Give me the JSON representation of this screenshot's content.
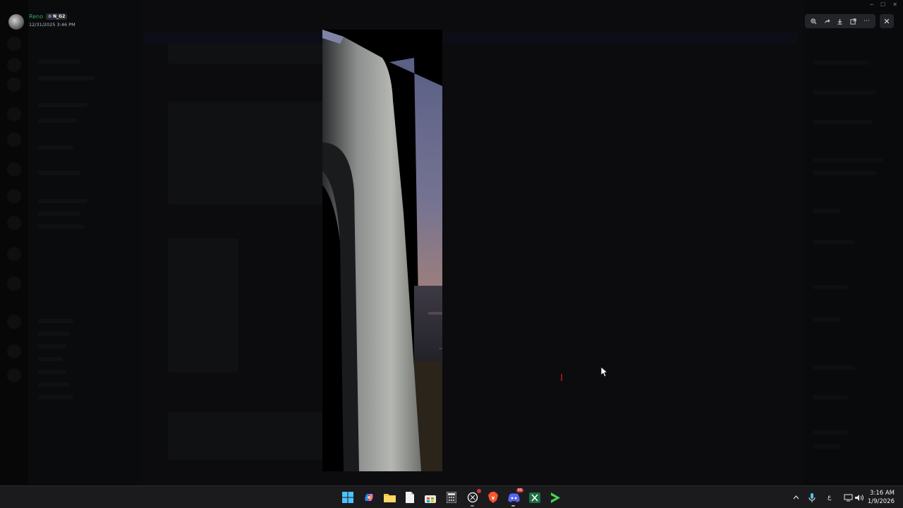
{
  "window": {
    "title": "",
    "controls": [
      "minimize-icon",
      "maximize-icon",
      "close-icon"
    ]
  },
  "viewer": {
    "author_name": "Reno",
    "author_tag": "N_G2",
    "timestamp": "12/31/2025 3:46 PM",
    "toolbar_icons": [
      "zoom-in-icon",
      "share-icon",
      "download-icon",
      "open-external-icon",
      "more-icon"
    ],
    "close_icon": "close-icon"
  },
  "taskbar": {
    "apps": [
      {
        "name": "start",
        "icon": "windows-start-icon"
      },
      {
        "name": "copilot",
        "icon": "copilot-icon"
      },
      {
        "name": "file-explorer",
        "icon": "folder-icon"
      },
      {
        "name": "notepad",
        "icon": "document-icon"
      },
      {
        "name": "store",
        "icon": "store-icon"
      },
      {
        "name": "calculator",
        "icon": "calculator-icon"
      },
      {
        "name": "chatgpt",
        "icon": "ai-icon"
      },
      {
        "name": "brave",
        "icon": "brave-icon"
      },
      {
        "name": "discord",
        "icon": "discord-icon",
        "badge": "99"
      },
      {
        "name": "excel",
        "icon": "excel-icon"
      },
      {
        "name": "media-player",
        "icon": "play-icon"
      }
    ],
    "tray_ime": "ع",
    "time": "3:16 AM",
    "date": "1/9/2026"
  },
  "colors": {
    "accent_green": "#3ba55c",
    "taskbar_bg": "#1b1b1e",
    "discord_blurple": "#5865f2",
    "brave_orange": "#fb542b"
  }
}
